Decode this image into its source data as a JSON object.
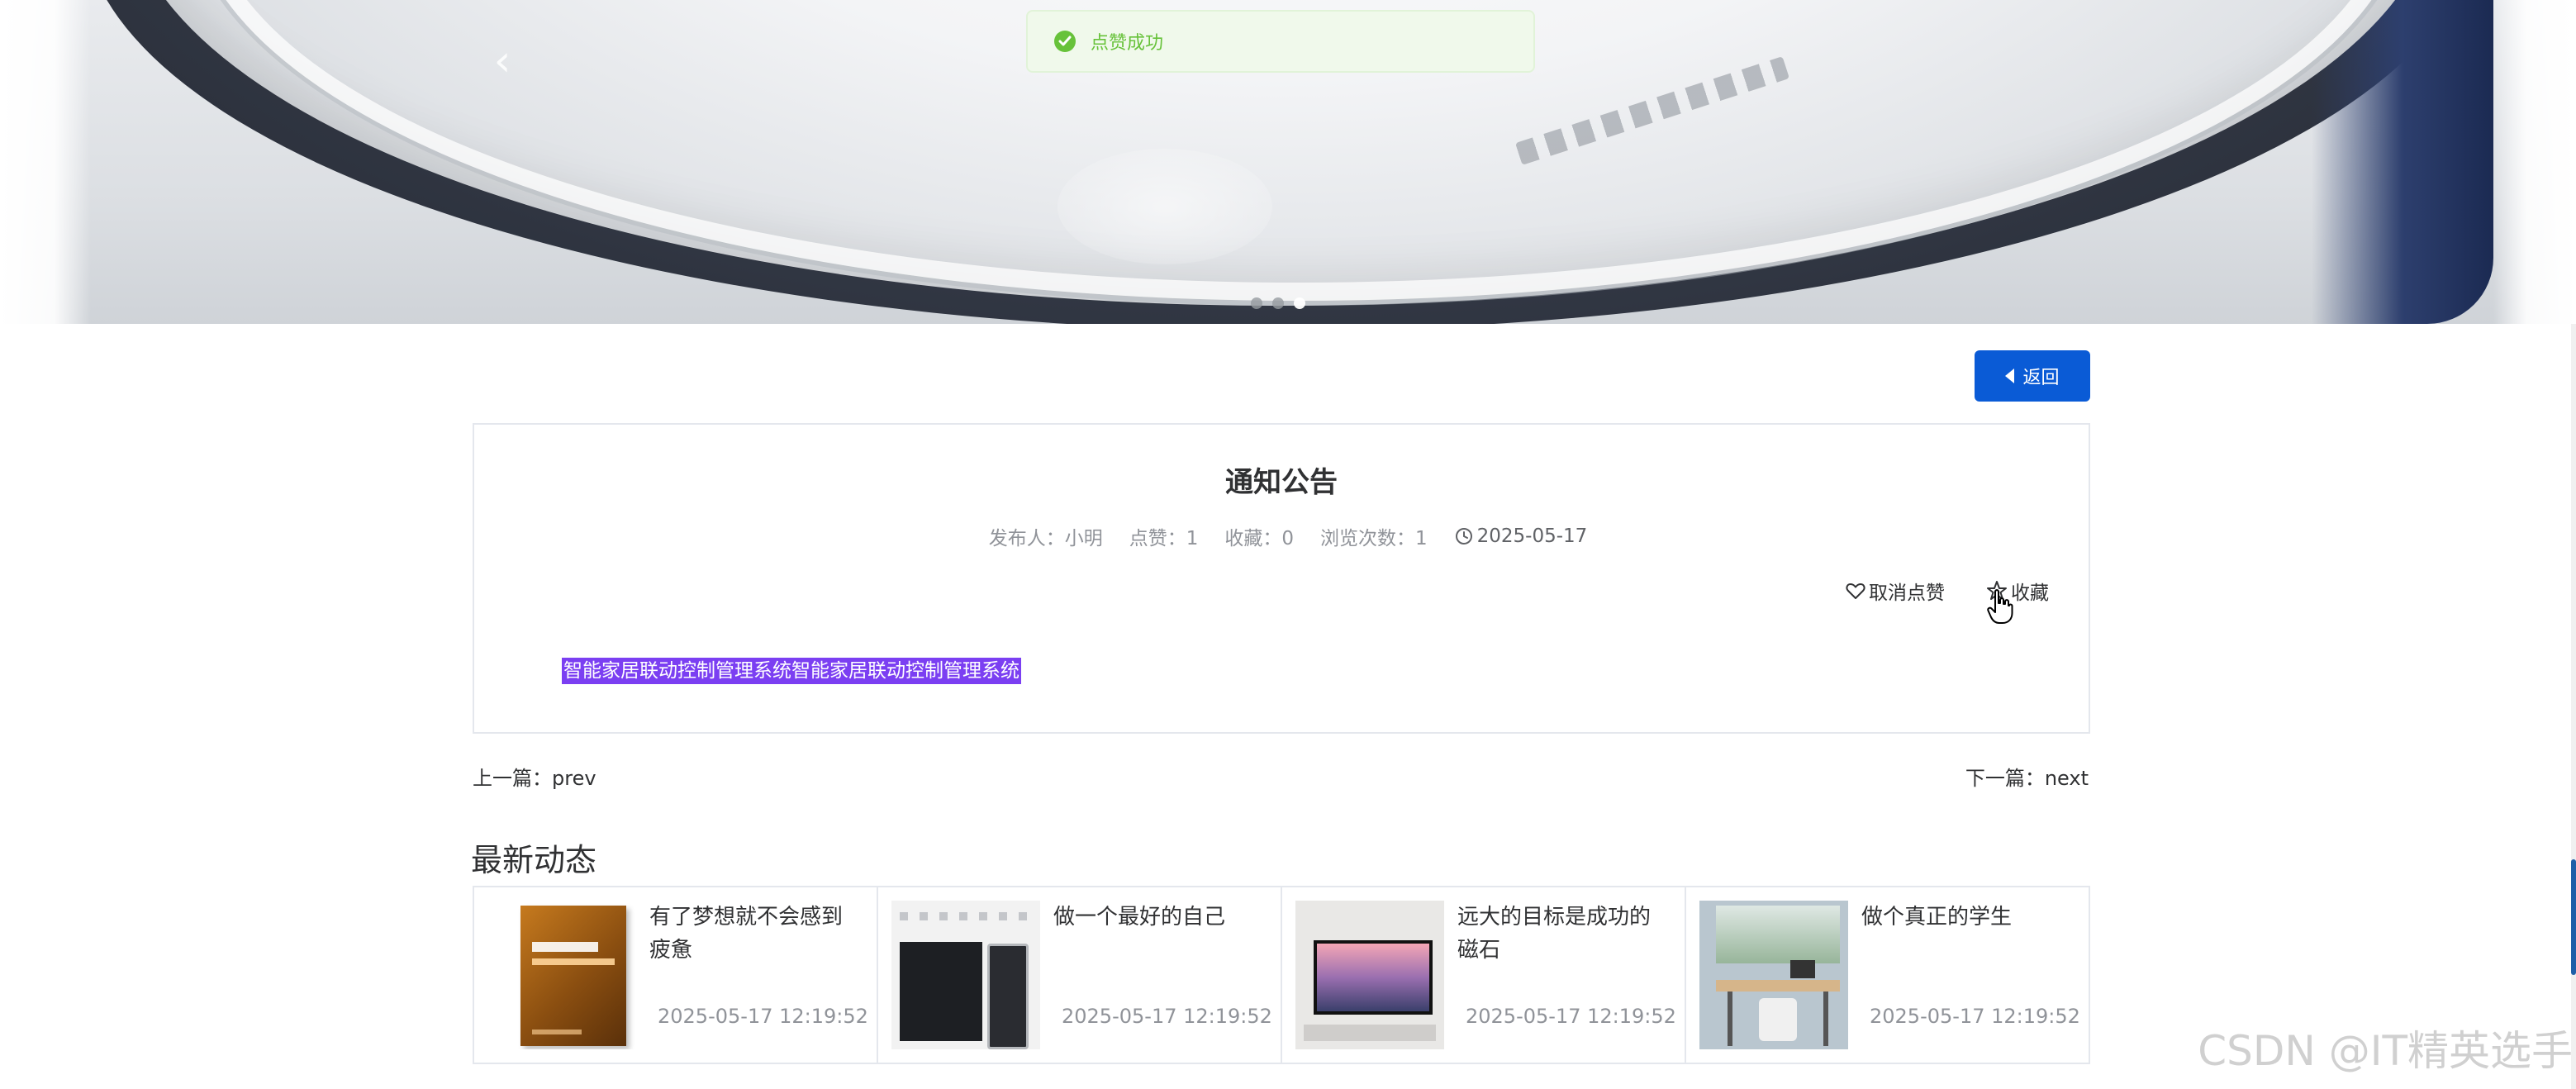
{
  "toast": {
    "text": "点赞成功"
  },
  "back_button": {
    "label": "返回"
  },
  "notice": {
    "title": "通知公告",
    "meta": {
      "publisher": "发布人：小明",
      "likes": "点赞：1",
      "favorites": "收藏：0",
      "views": "浏览次数：1",
      "date": "2025-05-17"
    },
    "actions": {
      "unlike": "取消点赞",
      "favorite": "收藏"
    },
    "content": "智能家居联动控制管理系统智能家居联动控制管理系统"
  },
  "pager": {
    "prev": "上一篇：prev",
    "next": "下一篇：next"
  },
  "latest": {
    "title": "最新动态",
    "items": [
      {
        "title": "有了梦想就不会感到疲惫",
        "time": "2025-05-17 12:19:52",
        "thumb": "book"
      },
      {
        "title": "做一个最好的自己",
        "time": "2025-05-17 12:19:52",
        "thumb": "phone"
      },
      {
        "title": "远大的目标是成功的磁石",
        "time": "2025-05-17 12:19:52",
        "thumb": "tv"
      },
      {
        "title": "做个真正的学生",
        "time": "2025-05-17 12:19:52",
        "thumb": "desk"
      }
    ]
  },
  "carousel": {
    "active_index": 2,
    "count": 3
  },
  "watermark": "CSDN @IT精英选手",
  "colors": {
    "primary": "#0a5bd6",
    "success": "#67c23a",
    "highlight": "#7b3ff2"
  }
}
